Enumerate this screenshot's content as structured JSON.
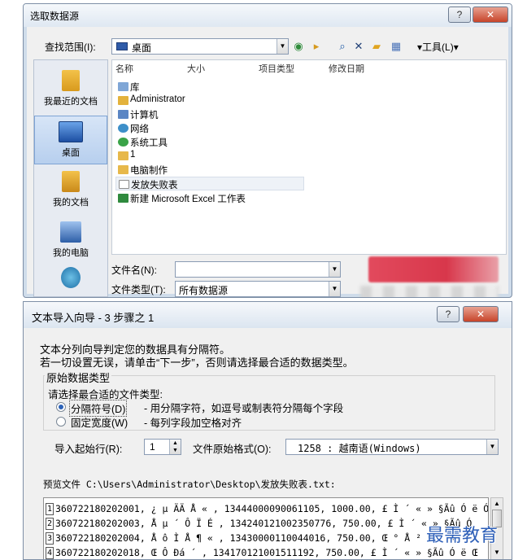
{
  "dialog1": {
    "title": "选取数据源",
    "look_in_label": "查找范围(I):",
    "look_in_value": "桌面",
    "tools_label": "▾工具(L)▾",
    "places": [
      {
        "label": "我最近的文档",
        "icon": "recent-docs-icon",
        "active": false
      },
      {
        "label": "桌面",
        "icon": "desktop-icon",
        "active": true
      },
      {
        "label": "我的文档",
        "icon": "my-documents-icon",
        "active": false
      },
      {
        "label": "我的电脑",
        "icon": "my-computer-icon",
        "active": false
      },
      {
        "label": "",
        "icon": "network-icon",
        "active": false
      }
    ],
    "columns": [
      "名称",
      "大小",
      "项目类型",
      "修改日期"
    ],
    "files": [
      {
        "name": "库",
        "icon": "library-icon"
      },
      {
        "name": "Administrator",
        "icon": "user-folder-icon"
      },
      {
        "name": "计算机",
        "icon": "computer-icon"
      },
      {
        "name": "网络",
        "icon": "network-icon"
      },
      {
        "name": "系统工具",
        "icon": "system-tools-icon"
      },
      {
        "name": "1",
        "icon": "folder-icon"
      },
      {
        "name": "电脑制作",
        "icon": "folder-icon"
      },
      {
        "name": "发放失败表",
        "icon": "text-file-icon",
        "selected": true
      },
      {
        "name": "新建 Microsoft Excel 工作表",
        "icon": "excel-file-icon"
      }
    ],
    "file_name_label": "文件名(N):",
    "file_name_value": "",
    "file_type_label": "文件类型(T):",
    "file_type_value": "所有数据源"
  },
  "dialog2": {
    "title": "文本导入向导 - 3 步骤之 1",
    "intro_line1": "文本分列向导判定您的数据具有分隔符。",
    "intro_line2": "若一切设置无误，请单击“下一步”，否则请选择最合适的数据类型。",
    "group_title": "原始数据类型",
    "prompt": "请选择最合适的文件类型:",
    "options": [
      {
        "label": "分隔符号(D)",
        "desc": "- 用分隔字符，如逗号或制表符分隔每个字段",
        "selected": true
      },
      {
        "label": "固定宽度(W)",
        "desc": "- 每列字段加空格对齐",
        "selected": false
      }
    ],
    "start_row_label": "导入起始行(R):",
    "start_row_value": "1",
    "file_origin_label": "文件原始格式(O):",
    "file_origin_value": "1258 : 越南语(Windows)",
    "preview_label": "预览文件 C:\\Users\\Administrator\\Desktop\\发放失败表.txt:",
    "preview_lines": [
      {
        "num": "1",
        "text": "360722180202001, ¿ µ ÄÄ Å « , 13444000090061105, 1000.00, £ Ì ´ « » §Ãû Ó ë Ó"
      },
      {
        "num": "2",
        "text": "360722180202003, Å µ ´ Ô Ï É , 134240121002350776, 750.00, £ Ì ´ « » §Ãû Ó"
      },
      {
        "num": "3",
        "text": "360722180202004, Å ô Ì Å ¶ « , 13430000110044016, 750.00, Œ ° Å ² » ´ «"
      },
      {
        "num": "4",
        "text": "360722180202018, Œ Ô Ðá ´ , 134170121001511192, 750.00, £ Ì ´ « » §Ãû Ó ë Œ"
      }
    ]
  },
  "watermark": "最需教育",
  "colors": {
    "accent": "#2c62b8",
    "close": "#c7442a",
    "watermark": "#2d5fb8"
  }
}
